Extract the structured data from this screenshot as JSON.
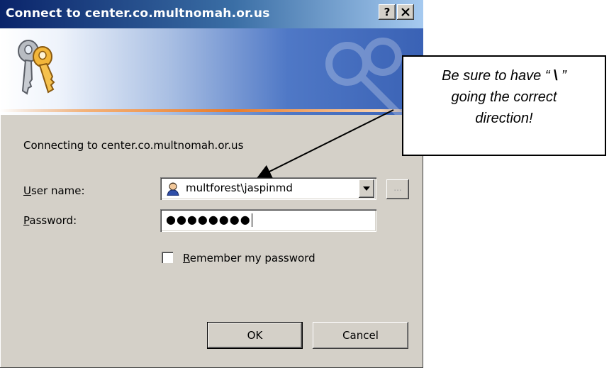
{
  "window": {
    "title": "Connect to center.co.multnomah.or.us",
    "help_label": "?",
    "close_label": "✕"
  },
  "banner": {
    "icon": "keys-icon",
    "accent_line_color": "#e87b2a"
  },
  "dialog": {
    "connecting_text": "Connecting to center.co.multnomah.or.us",
    "username": {
      "label_accel": "U",
      "label_rest": "ser name:",
      "value": "multforest\\jaspinmd",
      "icon": "user-icon"
    },
    "browse_label": "...",
    "password": {
      "label_accel": "P",
      "label_rest": "assword:",
      "masked_value": "●●●●●●●●"
    },
    "remember": {
      "label_accel": "R",
      "label_rest": "emember my password",
      "checked": false
    },
    "ok_label": "OK",
    "cancel_label": "Cancel"
  },
  "callout": {
    "line1_pre": "Be sure to have “ ",
    "line1_symbol": "\\",
    "line1_post": " ”",
    "line2": "going the correct",
    "line3": "direction!"
  }
}
